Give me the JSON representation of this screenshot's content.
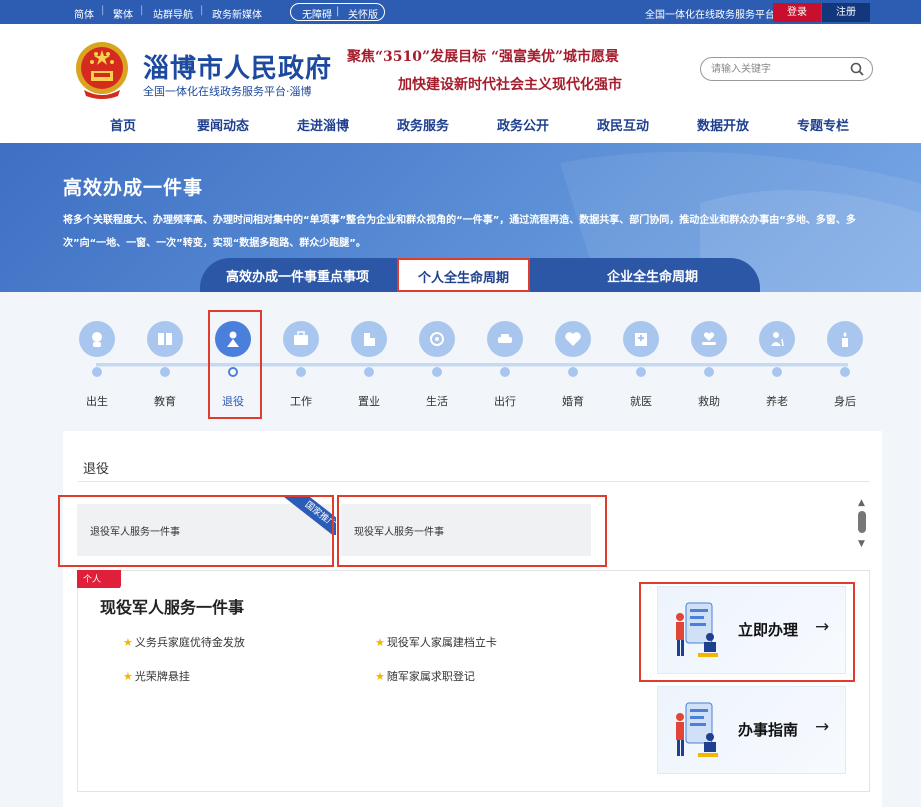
{
  "topbar": {
    "simplified": "简体",
    "traditional": "繁体",
    "site_nav": "站群导航",
    "new_media": "政务新媒体",
    "accessible": "无障碍",
    "care_mode": "关怀版",
    "platform_label": "全国一体化在线政务服务平台:",
    "login": "登录",
    "register": "注册"
  },
  "header": {
    "site_title": "淄博市人民政府",
    "site_subtitle": "全国一体化在线政务服务平台·淄博",
    "slogan_line1": "聚焦“3510”发展目标 “强富美优”城市愿景",
    "slogan_line2": "加快建设新时代社会主义现代化强市",
    "search_placeholder": "请输入关键字"
  },
  "nav": [
    "首页",
    "要闻动态",
    "走进淄博",
    "政务服务",
    "政务公开",
    "政民互动",
    "数据开放",
    "专题专栏"
  ],
  "banner": {
    "title": "高效办成一件事",
    "description": "将多个关联程度大、办理频率高、办理时间相对集中的“单项事”整合为企业和群众视角的“一件事”，通过流程再造、数据共享、部门协同，推动企业和群众办事由“多地、多窗、多次”向“一地、一窗、一次”转变，实现“数据多跑路、群众少跑腿”。",
    "tabs": [
      "高效办成一件事重点事项",
      "个人全生命周期",
      "企业全生命周期"
    ],
    "active_tab": "个人全生命周期"
  },
  "stages": [
    "出生",
    "教育",
    "退役",
    "工作",
    "置业",
    "生活",
    "出行",
    "婚育",
    "就医",
    "救助",
    "养老",
    "身后"
  ],
  "active_stage": "退役",
  "panel": {
    "title": "退役",
    "cards": [
      "退役军人服务一件事",
      "现役军人服务一件事"
    ],
    "ribbon": "国家推广",
    "detail": {
      "tag": "个人",
      "title": "现役军人服务一件事",
      "items": [
        "义务兵家庭优待金发放",
        "现役军人家属建档立卡",
        "光荣牌悬挂",
        "随军家属求职登记"
      ],
      "action_primary": "立即办理",
      "action_secondary": "办事指南",
      "arrow": "→"
    }
  },
  "colors": {
    "topbar": "#2d5db3",
    "brand_blue": "#1d4aa0",
    "highlight_red": "#e03c2e",
    "stage_icon": "#a9c6ef"
  }
}
